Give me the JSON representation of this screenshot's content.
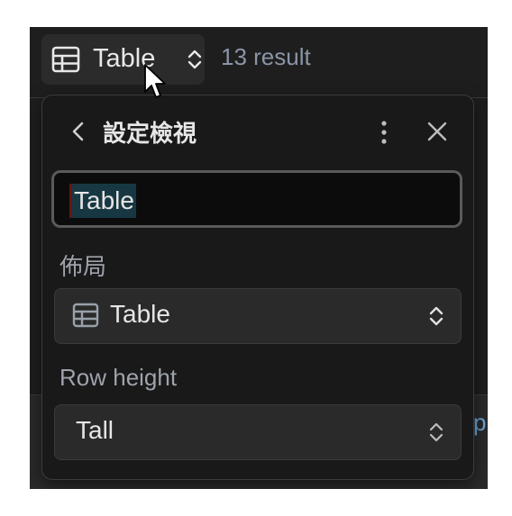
{
  "toolbar": {
    "view_label": "Table",
    "result_count": "13 result"
  },
  "panel": {
    "title": "設定檢視",
    "name_value": "Table",
    "layout_label": "佈局",
    "layout_value": "Table",
    "row_height_label": "Row height",
    "row_height_value": "Tall"
  },
  "background": {
    "edge_fragment": "p"
  }
}
